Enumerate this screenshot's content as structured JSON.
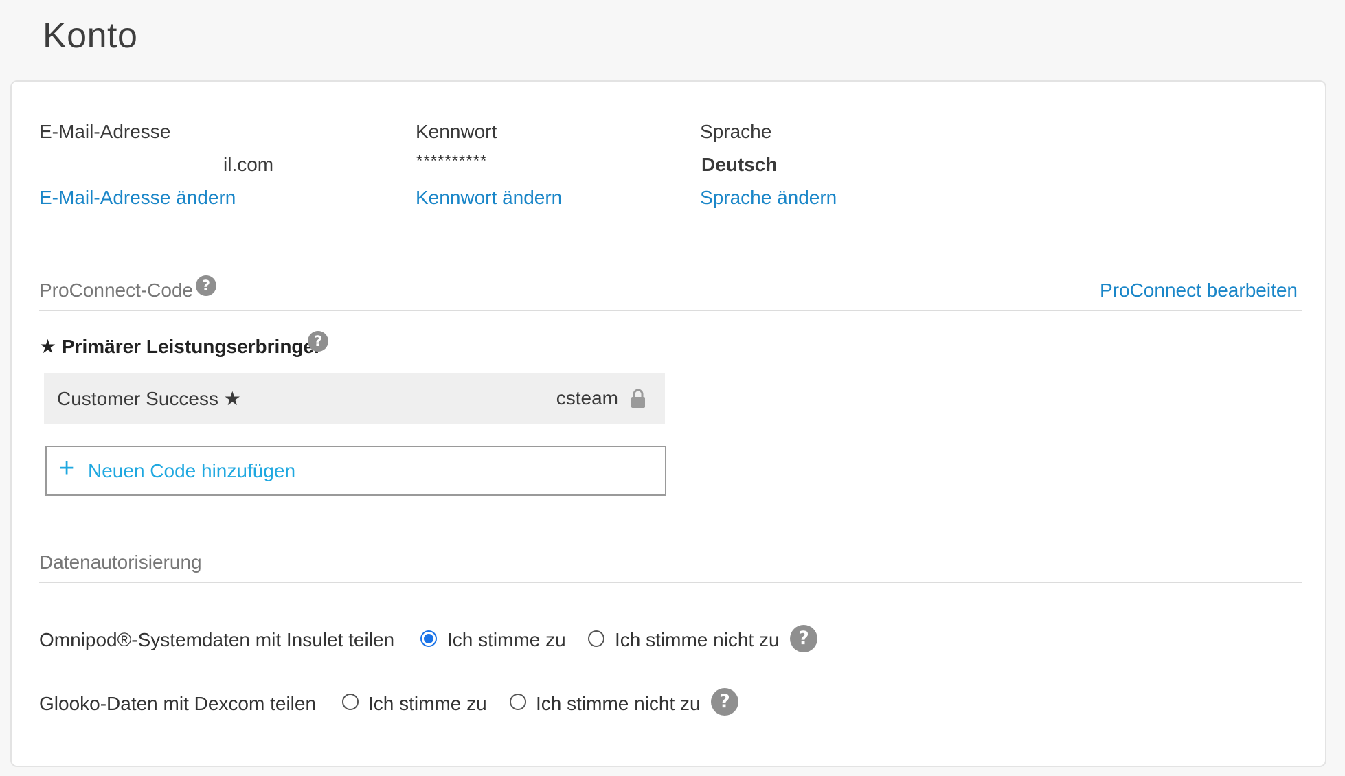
{
  "page": {
    "title": "Konto"
  },
  "account": {
    "email_label": "E-Mail-Adresse",
    "email_value": "il.com",
    "email_change": "E-Mail-Adresse ändern",
    "password_label": "Kennwort",
    "password_value": "**********",
    "password_change": "Kennwort ändern",
    "language_label": "Sprache",
    "language_value": "Deutsch",
    "language_change": "Sprache ändern"
  },
  "proconnect": {
    "title": "ProConnect-Code",
    "edit_link": "ProConnect bearbeiten",
    "primary_provider_title": "★ Primärer Leistungserbringer",
    "providers": [
      {
        "name": "Customer Success ★",
        "code": "csteam",
        "locked": true
      }
    ],
    "add_code_label": "Neuen Code hinzufügen",
    "add_code_icon": "plus-icon",
    "help_icon": "question-icon"
  },
  "authorization": {
    "title": "Datenautorisierung",
    "rows": [
      {
        "label": "Omnipod®-Systemdaten mit Insulet teilen",
        "agree": "Ich stimme zu",
        "disagree": "Ich stimme nicht zu",
        "selected": "agree"
      },
      {
        "label": "Glooko-Daten mit Dexcom teilen",
        "agree": "Ich stimme zu",
        "disagree": "Ich stimme nicht zu",
        "selected": "none"
      }
    ]
  },
  "colors": {
    "link": "#1a86c8",
    "add_code": "#1fa8e0",
    "radio_checked": "#1a73e8",
    "help_icon_bg": "#8f8f8f"
  }
}
